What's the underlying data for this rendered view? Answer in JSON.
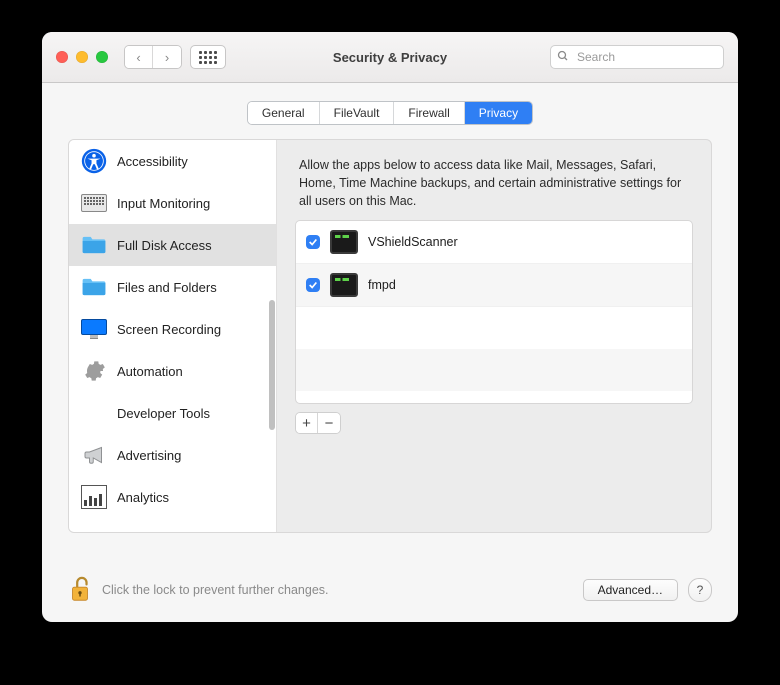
{
  "window": {
    "title": "Security & Privacy"
  },
  "search": {
    "placeholder": "Search"
  },
  "tabs": [
    {
      "label": "General",
      "selected": false
    },
    {
      "label": "FileVault",
      "selected": false
    },
    {
      "label": "Firewall",
      "selected": false
    },
    {
      "label": "Privacy",
      "selected": true
    }
  ],
  "sidebar": {
    "items": [
      {
        "label": "Accessibility",
        "icon": "accessibility"
      },
      {
        "label": "Input Monitoring",
        "icon": "keyboard"
      },
      {
        "label": "Full Disk Access",
        "icon": "folder",
        "selected": true
      },
      {
        "label": "Files and Folders",
        "icon": "folder"
      },
      {
        "label": "Screen Recording",
        "icon": "screen"
      },
      {
        "label": "Automation",
        "icon": "gear"
      },
      {
        "label": "Developer Tools",
        "icon": "none"
      },
      {
        "label": "Advertising",
        "icon": "horn"
      },
      {
        "label": "Analytics",
        "icon": "bars"
      }
    ]
  },
  "main": {
    "description": "Allow the apps below to access data like Mail, Messages, Safari, Home, Time Machine backups, and certain administrative settings for all users on this Mac.",
    "apps": [
      {
        "name": "VShieldScanner",
        "checked": true
      },
      {
        "name": "fmpd",
        "checked": true
      }
    ]
  },
  "footer": {
    "lock_text": "Click the lock to prevent further changes.",
    "advanced_label": "Advanced…",
    "help_label": "?"
  }
}
